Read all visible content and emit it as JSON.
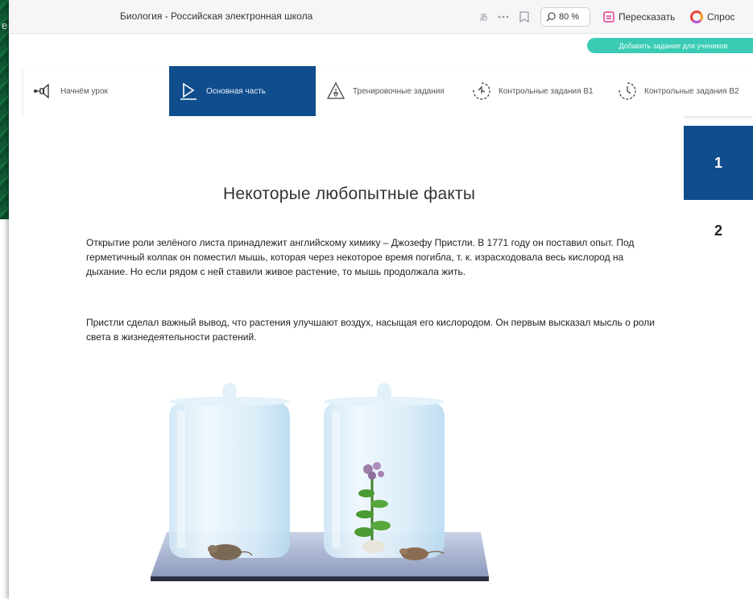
{
  "background_window": {
    "visible_letter": "e"
  },
  "browser": {
    "tab_title": "Биология - Российская электронная школа",
    "zoom_label": "80 %",
    "retell_label": "Пересказать",
    "ask_label": "Спрос"
  },
  "teal_pill": {
    "label": "Добавить задание для учеников"
  },
  "lesson_nav": {
    "items": [
      {
        "label": "Начнём урок",
        "icon": "megaphone-icon",
        "active": false
      },
      {
        "label": "Основная часть",
        "icon": "play-icon",
        "active": true
      },
      {
        "label": "Тренировочные задания",
        "icon": "flask-icon",
        "active": false
      },
      {
        "label": "Контрольные задания В1",
        "icon": "timer-icon",
        "active": false
      },
      {
        "label": "Контрольные задания В2",
        "icon": "timer-icon",
        "active": false
      }
    ]
  },
  "content": {
    "title": "Некоторые любопытные факты",
    "paragraph1": "Открытие роли зелёного листа принадлежит английскому химику – Джозефу Пристли. В 1771 году он поставил опыт. Под герметичный колпак он поместил мышь, которая через некоторое время погибла, т. к. израсходовала весь кислород на дыхание. Но если рядом с ней ставили живое растение, то мышь продолжала жить.",
    "paragraph2": "Пристли сделал важный вывод, что растения улучшают воздух, насыщая его кислородом. Он первым высказал мысль о роли света в жизнедеятельности растений."
  },
  "slides": {
    "items": [
      "1",
      "2"
    ],
    "active": "1"
  },
  "colors": {
    "active_blue": "#0f4d8c",
    "teal": "#3bcbb4",
    "bg_green": "#0f5a36"
  }
}
